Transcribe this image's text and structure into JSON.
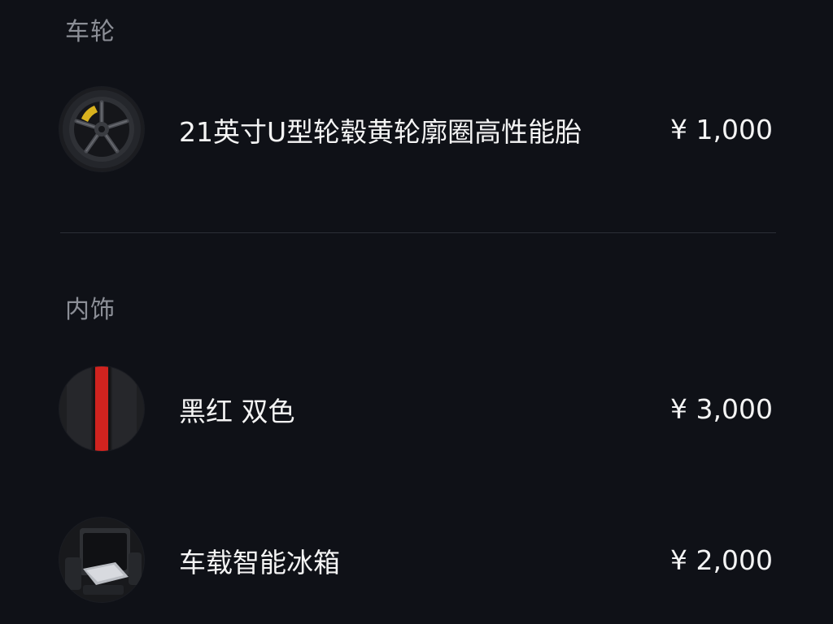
{
  "sections": [
    {
      "title": "车轮",
      "items": [
        {
          "name": "21英寸U型轮毂黄轮廓圈高性能胎",
          "price": "¥ 1,000",
          "icon": "wheel-icon"
        }
      ]
    },
    {
      "title": "内饰",
      "items": [
        {
          "name": "黑红 双色",
          "price": "¥ 3,000",
          "icon": "interior-swatch-icon"
        },
        {
          "name": "车载智能冰箱",
          "price": "¥ 2,000",
          "icon": "fridge-icon"
        }
      ]
    }
  ],
  "colors": {
    "background": "#0f1117",
    "section_title": "#8c8f97",
    "text": "#f4f4f4",
    "divider": "#2b2e36",
    "accent_red": "#d0231f",
    "caliper_yellow": "#d9b21e"
  }
}
